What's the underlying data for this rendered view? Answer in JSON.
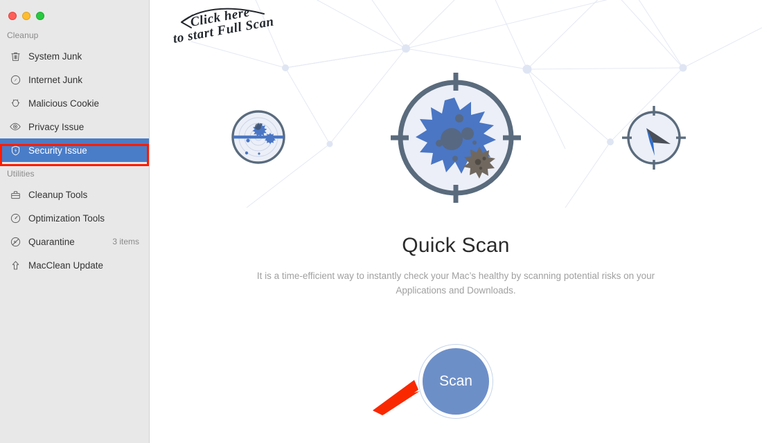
{
  "window": {
    "traffic_lights": [
      {
        "name": "close",
        "color": "#ff5f57"
      },
      {
        "name": "minimize",
        "color": "#ffbd2e"
      },
      {
        "name": "maximize",
        "color": "#28c940"
      }
    ]
  },
  "sidebar": {
    "groups": [
      {
        "label": "Cleanup",
        "items": [
          {
            "label": "System Junk",
            "icon": "trash-icon",
            "badge": "",
            "selected": false
          },
          {
            "label": "Internet Junk",
            "icon": "compass-icon",
            "badge": "",
            "selected": false
          },
          {
            "label": "Malicious Cookie",
            "icon": "cookie-bug-icon",
            "badge": "",
            "selected": false
          },
          {
            "label": "Privacy Issue",
            "icon": "eye-icon",
            "badge": "",
            "selected": false
          },
          {
            "label": "Security Issue",
            "icon": "shield-bolt-icon",
            "badge": "",
            "selected": true
          }
        ]
      },
      {
        "label": "Utilities",
        "items": [
          {
            "label": "Cleanup Tools",
            "icon": "toolbox-icon",
            "badge": "",
            "selected": false
          },
          {
            "label": "Optimization Tools",
            "icon": "speedometer-icon",
            "badge": "",
            "selected": false
          },
          {
            "label": "Quarantine",
            "icon": "no-entry-icon",
            "badge": "3 items",
            "selected": false
          },
          {
            "label": "MacClean Update",
            "icon": "upload-arrow-icon",
            "badge": "",
            "selected": false
          }
        ]
      }
    ],
    "selected_highlight_color": "#4a7dc8",
    "annotation_border_color": "#ff1a00"
  },
  "main": {
    "hint_line1": "Click here",
    "hint_line2": "to start Full Scan",
    "title": "Quick Scan",
    "description": "It is a time-efficient way to instantly check your Mac’s healthy by scanning potential risks on your Applications and Downloads.",
    "scan_button_label": "Scan",
    "scan_button_color": "#6d8fc8",
    "annotation_arrow_color": "#fa2800",
    "illustrations": [
      {
        "name": "radar-scanner-icon",
        "position": "left"
      },
      {
        "name": "virus-crosshair-icon",
        "position": "center"
      },
      {
        "name": "compass-icon",
        "position": "right"
      }
    ],
    "accent_color": "#4a7dc8",
    "virus_color": "#4a76c4",
    "outline_color": "#5a6b7d"
  }
}
